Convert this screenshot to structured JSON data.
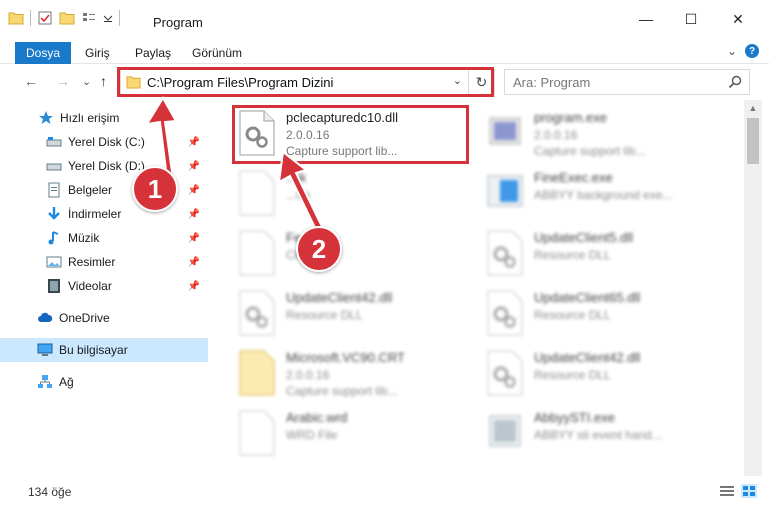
{
  "window": {
    "title": "Program",
    "minimize": "—",
    "maximize": "☐",
    "close": "✕"
  },
  "ribbon": {
    "tabs": [
      "Dosya",
      "Giriş",
      "Paylaş",
      "Görünüm"
    ],
    "expand": "⌄",
    "help": "?"
  },
  "nav": {
    "back": "←",
    "forward": "→",
    "recent": "⌄",
    "up": "↑",
    "address": "C:\\Program Files\\Program Dizini",
    "address_dropdown": "⌄",
    "refresh": "↻",
    "search_placeholder": "Ara: Program"
  },
  "sidebar": {
    "quick_access": "Hızlı erişim",
    "items": [
      {
        "label": "Yerel Disk (C:)",
        "icon": "drive-icon",
        "pinned": true
      },
      {
        "label": "Yerel Disk (D:)",
        "icon": "drive-icon",
        "pinned": true
      },
      {
        "label": "Belgeler",
        "icon": "documents-icon",
        "pinned": true
      },
      {
        "label": "İndirmeler",
        "icon": "download-icon",
        "pinned": true
      },
      {
        "label": "Müzik",
        "icon": "music-icon",
        "pinned": true
      },
      {
        "label": "Resimler",
        "icon": "pictures-icon",
        "pinned": true
      },
      {
        "label": "Videolar",
        "icon": "videos-icon",
        "pinned": true
      }
    ],
    "onedrive": "OneDrive",
    "this_pc": "Bu bilgisayar",
    "network": "Ağ",
    "pin_glyph": "📌"
  },
  "files": {
    "highlighted": {
      "name": "pclecapturedc10.dll",
      "version": "2.0.0.16",
      "description": "Capture support lib..."
    },
    "left_column": [
      {
        "name": "...jk",
        "version": "",
        "description": "...Ck"
      },
      {
        "name": "Fe...jk",
        "version": "",
        "description": "CK..."
      },
      {
        "name": "UpdateClient42.dll",
        "version": "",
        "description": "Resource DLL"
      },
      {
        "name": "Microsoft.VC90.CRT",
        "version": "2.0.0.16",
        "description": "Capture support lib..."
      },
      {
        "name": "Arabic.wrd",
        "version": "",
        "description": "WRD File"
      }
    ],
    "right_column": [
      {
        "name": "program.exe",
        "version": "2.0.0.16",
        "description": "Capture support lib..."
      },
      {
        "name": "FineExec.exe",
        "version": "",
        "description": "ABBYY background exe..."
      },
      {
        "name": "UpdateClient5.dll",
        "version": "",
        "description": "Resource DLL"
      },
      {
        "name": "UpdateClient65.dll",
        "version": "",
        "description": "Resource DLL"
      },
      {
        "name": "UpdateClient42.dll",
        "version": "",
        "description": "Resource DLL"
      },
      {
        "name": "AbbyySTI.exe",
        "version": "",
        "description": "ABBYY sti event hand..."
      }
    ]
  },
  "status": {
    "count": "134 öğe"
  },
  "annotations": {
    "step1": "1",
    "step2": "2",
    "color": "#d6323a"
  }
}
